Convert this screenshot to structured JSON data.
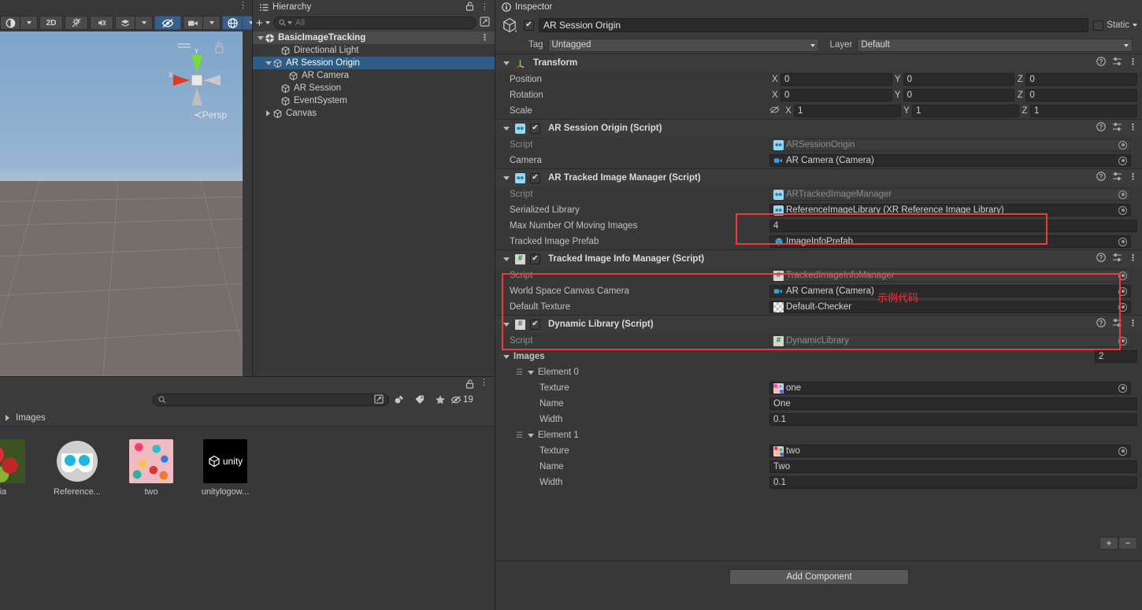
{
  "scene_view": {
    "toolbar": [
      {
        "name": "draw-mode-dropdown",
        "label": "◐"
      },
      {
        "name": "2d-toggle",
        "label": "2D"
      },
      {
        "name": "lighting-toggle",
        "label": "☀"
      },
      {
        "name": "audio-toggle",
        "label": "♪"
      },
      {
        "name": "fx-dropdown",
        "label": "≋"
      },
      {
        "name": "scene-visibility-toggle",
        "label": "👁"
      },
      {
        "name": "camera-settings-dropdown",
        "label": "▣"
      },
      {
        "name": "gizmos-dropdown",
        "label": "◍"
      }
    ],
    "gizmo": {
      "x_axis": "X",
      "y_axis": "Y",
      "projection": "Persp"
    }
  },
  "hierarchy": {
    "tab_label": "Hierarchy",
    "create_label": "+",
    "search_placeholder": "All",
    "items": [
      {
        "label": "BasicImageTracking",
        "depth": 0,
        "kind": "scene",
        "expanded": true,
        "selected": false
      },
      {
        "label": "Directional Light",
        "depth": 2,
        "kind": "go",
        "expanded": null,
        "selected": false
      },
      {
        "label": "AR Session Origin",
        "depth": 1,
        "kind": "go",
        "expanded": true,
        "selected": true
      },
      {
        "label": "AR Camera",
        "depth": 3,
        "kind": "go",
        "expanded": null,
        "selected": false
      },
      {
        "label": "AR Session",
        "depth": 2,
        "kind": "go",
        "expanded": null,
        "selected": false
      },
      {
        "label": "EventSystem",
        "depth": 2,
        "kind": "go",
        "expanded": null,
        "selected": false
      },
      {
        "label": "Canvas",
        "depth": 1,
        "kind": "go",
        "expanded": false,
        "selected": false
      }
    ]
  },
  "project": {
    "search_placeholder": "",
    "breadcrumb": "Images",
    "hidden_count": "19",
    "assets": [
      {
        "name": "ia",
        "thumb": "strawberry"
      },
      {
        "name": "Reference...",
        "thumb": "goggles"
      },
      {
        "name": "two",
        "thumb": "confetti"
      },
      {
        "name": "unitylogow...",
        "thumb": "unity"
      }
    ]
  },
  "inspector": {
    "tab_label": "Inspector",
    "object_name": "AR Session Origin",
    "enabled": true,
    "static_label": "Static",
    "tag_label": "Tag",
    "tag_value": "Untagged",
    "layer_label": "Layer",
    "layer_value": "Default",
    "add_component_label": "Add Component",
    "array_add_label": "+",
    "array_remove_label": "−",
    "annotation_text": "示例代码",
    "annotation_color": "#ff2d2d",
    "components": [
      {
        "name": "Transform",
        "icon": "transform-icon",
        "has_checkbox": false,
        "expanded": true,
        "rows": [
          {
            "label": "Position",
            "type": "vector3",
            "x": "0",
            "y": "0",
            "z": "0"
          },
          {
            "label": "Rotation",
            "type": "vector3",
            "x": "0",
            "y": "0",
            "z": "0"
          },
          {
            "label": "Scale",
            "type": "vector3",
            "x": "1",
            "y": "1",
            "z": "1",
            "has_constrain": true
          }
        ]
      },
      {
        "name": "AR Session Origin (Script)",
        "icon": "script-blue-icon",
        "has_checkbox": true,
        "checked": true,
        "expanded": true,
        "rows": [
          {
            "label": "Script",
            "type": "object",
            "value": "ARSessionOrigin",
            "icon": "script-blue",
            "readonly": true
          },
          {
            "label": "Camera",
            "type": "object",
            "value": "AR Camera (Camera)",
            "icon": "camera-blue",
            "readonly": false
          }
        ]
      },
      {
        "name": "AR Tracked Image Manager (Script)",
        "icon": "script-blue-icon",
        "has_checkbox": true,
        "checked": true,
        "expanded": true,
        "rows": [
          {
            "label": "Script",
            "type": "object",
            "value": "ARTrackedImageManager",
            "icon": "script-blue",
            "readonly": true
          },
          {
            "label": "Serialized Library",
            "type": "object",
            "value": "ReferenceImageLibrary (XR Reference Image Library)",
            "icon": "script-blue",
            "readonly": false
          },
          {
            "label": "Max Number Of Moving Images",
            "type": "text",
            "value": "4"
          },
          {
            "label": "Tracked Image Prefab",
            "type": "object",
            "value": "ImageInfoPrefab",
            "icon": "prefab-blue",
            "readonly": false
          }
        ]
      },
      {
        "name": "Tracked Image Info Manager (Script)",
        "icon": "script-green-icon",
        "has_checkbox": true,
        "checked": true,
        "expanded": true,
        "rows": [
          {
            "label": "Script",
            "type": "object",
            "value": "TrackedImageInfoManager",
            "icon": "script-green",
            "readonly": true
          },
          {
            "label": "World Space Canvas Camera",
            "type": "object",
            "value": "AR Camera (Camera)",
            "icon": "camera-blue",
            "readonly": false
          },
          {
            "label": "Default Texture",
            "type": "object",
            "value": "Default-Checker",
            "icon": "checker",
            "readonly": false
          }
        ]
      },
      {
        "name": "Dynamic Library (Script)",
        "icon": "script-green-icon",
        "has_checkbox": true,
        "checked": true,
        "expanded": true,
        "rows": [
          {
            "label": "Script",
            "type": "object",
            "value": "DynamicLibrary",
            "icon": "script-green",
            "readonly": true
          }
        ]
      }
    ],
    "images_array": {
      "label": "Images",
      "size": "2",
      "elements": [
        {
          "label": "Element 0",
          "texture_label": "Texture",
          "texture_value": "one",
          "texture_thumb": "one",
          "name_label": "Name",
          "name_value": "One",
          "width_label": "Width",
          "width_value": "0.1"
        },
        {
          "label": "Element 1",
          "texture_label": "Texture",
          "texture_value": "two",
          "texture_thumb": "two",
          "name_label": "Name",
          "name_value": "Two",
          "width_label": "Width",
          "width_value": "0.1"
        }
      ]
    }
  }
}
